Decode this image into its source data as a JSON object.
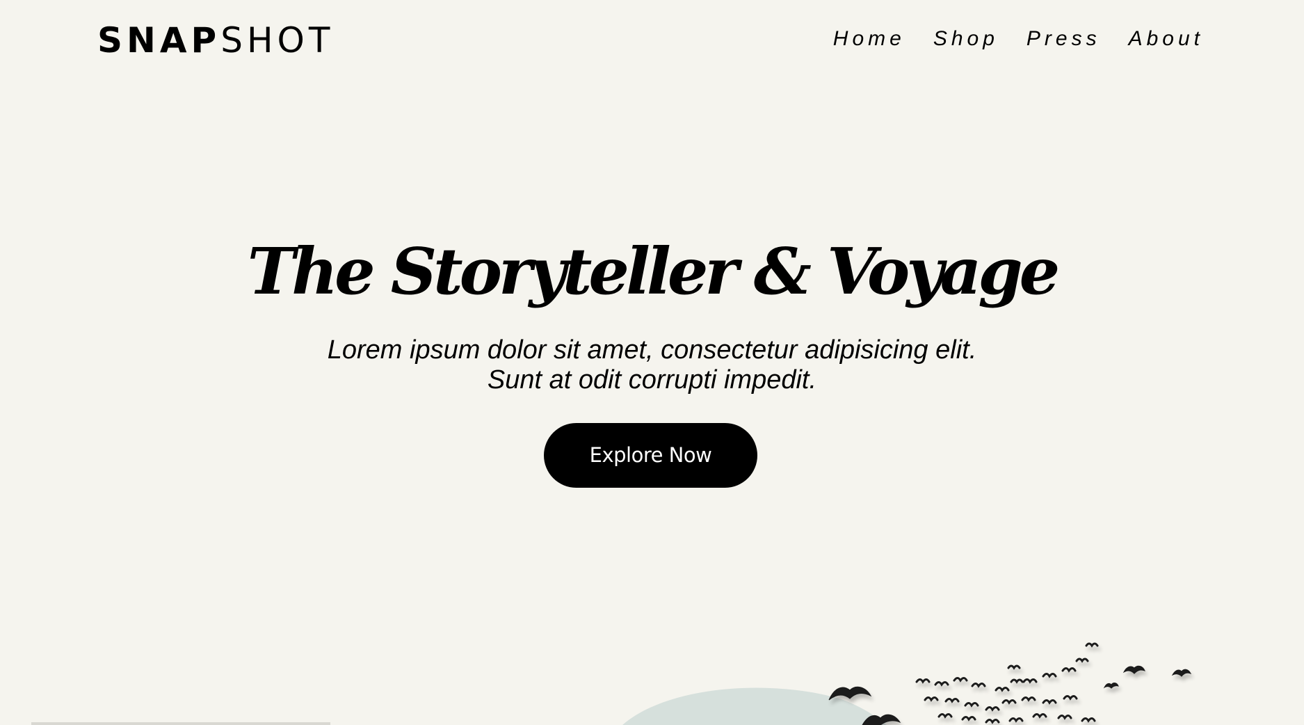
{
  "brand": {
    "bold": "SNAP",
    "light": "SHOT"
  },
  "nav": {
    "items": [
      {
        "label": "Home"
      },
      {
        "label": "Shop"
      },
      {
        "label": "Press"
      },
      {
        "label": "About"
      }
    ]
  },
  "hero": {
    "title": "The Storyteller & Voyage",
    "subtitle_line1": "Lorem ipsum dolor sit amet, consectetur adipisicing elit.",
    "subtitle_line2": "Sunt at odit corrupti impedit.",
    "cta_label": "Explore Now"
  },
  "colors": {
    "background": "#f5f4ee",
    "text": "#000000",
    "button_bg": "#000000",
    "button_text": "#ffffff",
    "moon": "#d6e0dc"
  },
  "illustration": {
    "icons": [
      "moon-icon",
      "bird-flock-icon"
    ]
  }
}
